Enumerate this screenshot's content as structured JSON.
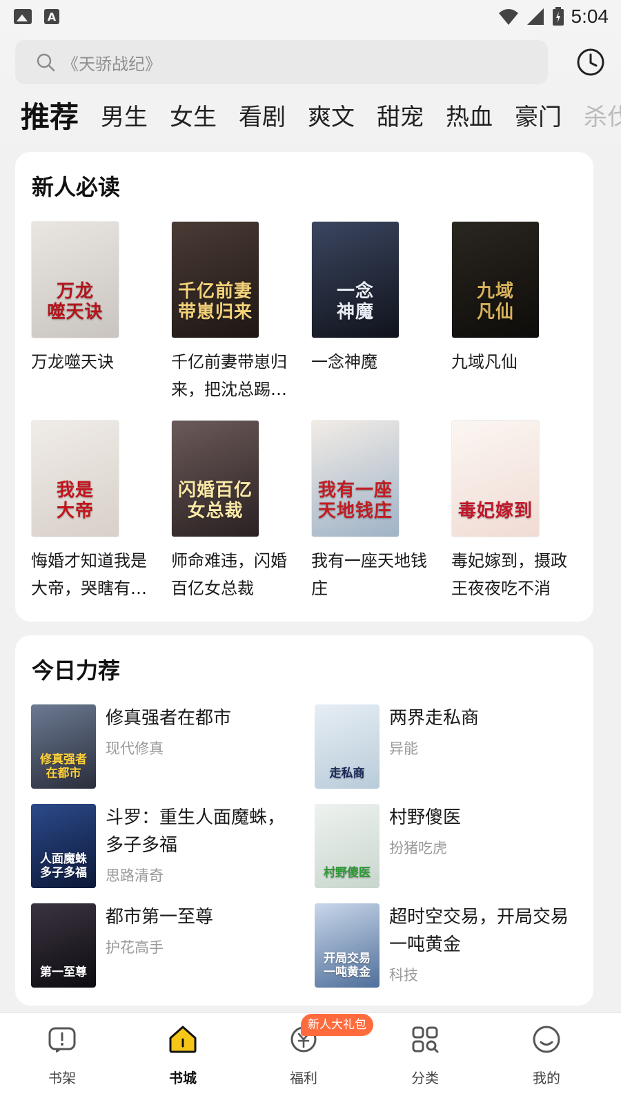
{
  "status_bar": {
    "time": "5:04"
  },
  "search": {
    "placeholder": "《天骄战纪》"
  },
  "tabs": [
    "推荐",
    "男生",
    "女生",
    "看剧",
    "爽文",
    "甜宠",
    "热血",
    "豪门",
    "杀伐"
  ],
  "section_new": {
    "title": "新人必读",
    "books": [
      {
        "title": "万龙噬天诀",
        "cover_text": "万龙\n噬天诀",
        "cover_bg": [
          "#e9e6e2",
          "#c9c4bf"
        ],
        "cover_fg": "#b3141b"
      },
      {
        "title": "千亿前妻带崽归来，把沈总踢出户口本",
        "cover_text": "千亿前妻\n带崽归来",
        "cover_bg": [
          "#4a3b35",
          "#1e1714"
        ],
        "cover_fg": "#f4d27a"
      },
      {
        "title": "一念神魔",
        "cover_text": "一念\n神魔",
        "cover_bg": [
          "#3b4660",
          "#10131c"
        ],
        "cover_fg": "#e7ecf5"
      },
      {
        "title": "九域凡仙",
        "cover_text": "九域\n凡仙",
        "cover_bg": [
          "#2a2620",
          "#0e0c0a"
        ],
        "cover_fg": "#d8b25b"
      },
      {
        "title": "悔婚才知道我是大帝，哭瞎有何用？",
        "cover_text": "我是\n大帝",
        "cover_bg": [
          "#f0ece8",
          "#d8d0c9"
        ],
        "cover_fg": "#c2141c"
      },
      {
        "title": "师命难违，闪婚百亿女总裁",
        "cover_text": "闪婚百亿\n女总裁",
        "cover_bg": [
          "#6b5a58",
          "#2a2122"
        ],
        "cover_fg": "#fbe9a8"
      },
      {
        "title": "我有一座天地钱庄",
        "cover_text": "我有一座\n天地钱庄",
        "cover_bg": [
          "#f2ece6",
          "#9fb3c7"
        ],
        "cover_fg": "#c01d22"
      },
      {
        "title": "毒妃嫁到，摄政王夜夜吃不消",
        "cover_text": "毒妃嫁到",
        "cover_bg": [
          "#fbf6f2",
          "#f0dcd4"
        ],
        "cover_fg": "#c0172a"
      }
    ]
  },
  "section_today": {
    "title": "今日力荐",
    "books": [
      {
        "title": "修真强者在都市",
        "category": "现代修真",
        "cover_text": "修真强者\n在都市",
        "cover_bg": [
          "#6c7a92",
          "#2a2e3c"
        ],
        "cover_fg": "#ffd23a"
      },
      {
        "title": "两界走私商",
        "category": "异能",
        "cover_text": "走私商",
        "cover_bg": [
          "#e6eef4",
          "#b9cbd9"
        ],
        "cover_fg": "#1b2a5a"
      },
      {
        "title": "斗罗：重生人面魔蛛，多子多福",
        "category": "思路清奇",
        "cover_text": "人面魔蛛\n多子多福",
        "cover_bg": [
          "#2c4a8a",
          "#0c1838"
        ],
        "cover_fg": "#ffffff"
      },
      {
        "title": "村野傻医",
        "category": "扮猪吃虎",
        "cover_text": "村野傻医",
        "cover_bg": [
          "#eef2ef",
          "#c8d6cd"
        ],
        "cover_fg": "#2f9a36"
      },
      {
        "title": "都市第一至尊",
        "category": "护花高手",
        "cover_text": "第一至尊",
        "cover_bg": [
          "#3b3440",
          "#0d0b10"
        ],
        "cover_fg": "#ffffff"
      },
      {
        "title": "超时空交易，开局交易一吨黄金",
        "category": "科技",
        "cover_text": "开局交易\n一吨黄金",
        "cover_bg": [
          "#c9d7ea",
          "#4f6f9a"
        ],
        "cover_fg": "#ffffff"
      }
    ]
  },
  "bottom_nav": {
    "items": [
      {
        "label": "书架",
        "icon": "bookshelf-icon"
      },
      {
        "label": "书城",
        "icon": "bookstore-home-icon"
      },
      {
        "label": "福利",
        "icon": "welfare-coin-icon"
      },
      {
        "label": "分类",
        "icon": "category-grid-icon"
      },
      {
        "label": "我的",
        "icon": "profile-smile-icon"
      }
    ],
    "gift_badge": "新人大礼包"
  }
}
